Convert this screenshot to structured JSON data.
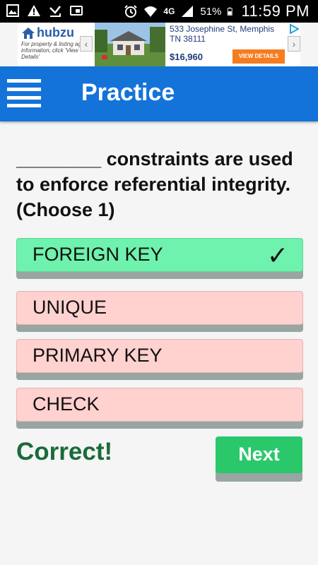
{
  "status_bar": {
    "battery_percent": "51%",
    "time": "11:59 PM",
    "network_label": "4G",
    "icons": [
      "image-icon",
      "warning-icon",
      "missed-call-icon",
      "cast-icon",
      "alarm-icon",
      "wifi-icon",
      "signal-icon",
      "battery-icon"
    ]
  },
  "ad": {
    "brand": "hubzu",
    "tagline": "For property & listing agent information, click 'View Details'",
    "address": "533 Josephine St, Memphis TN 38111",
    "price": "$16,960",
    "cta": "VIEW DETAILS",
    "colors": {
      "brand": "#2b5ea8",
      "cta": "#f57c1f"
    }
  },
  "app_bar": {
    "title": "Practice",
    "color": "#1473d9"
  },
  "question": {
    "text": "________ constraints are used to enforce referential integrity. (Choose 1)"
  },
  "options": [
    {
      "label": "FOREIGN KEY",
      "state": "correct",
      "selected": true,
      "mark": "✓"
    },
    {
      "label": "UNIQUE",
      "state": "wrong"
    },
    {
      "label": "PRIMARY KEY",
      "state": "wrong"
    },
    {
      "label": "CHECK",
      "state": "wrong"
    }
  ],
  "result": {
    "text": "Correct!",
    "color": "#1a6b3a"
  },
  "next_button": {
    "label": "Next",
    "color": "#2bc76b"
  }
}
